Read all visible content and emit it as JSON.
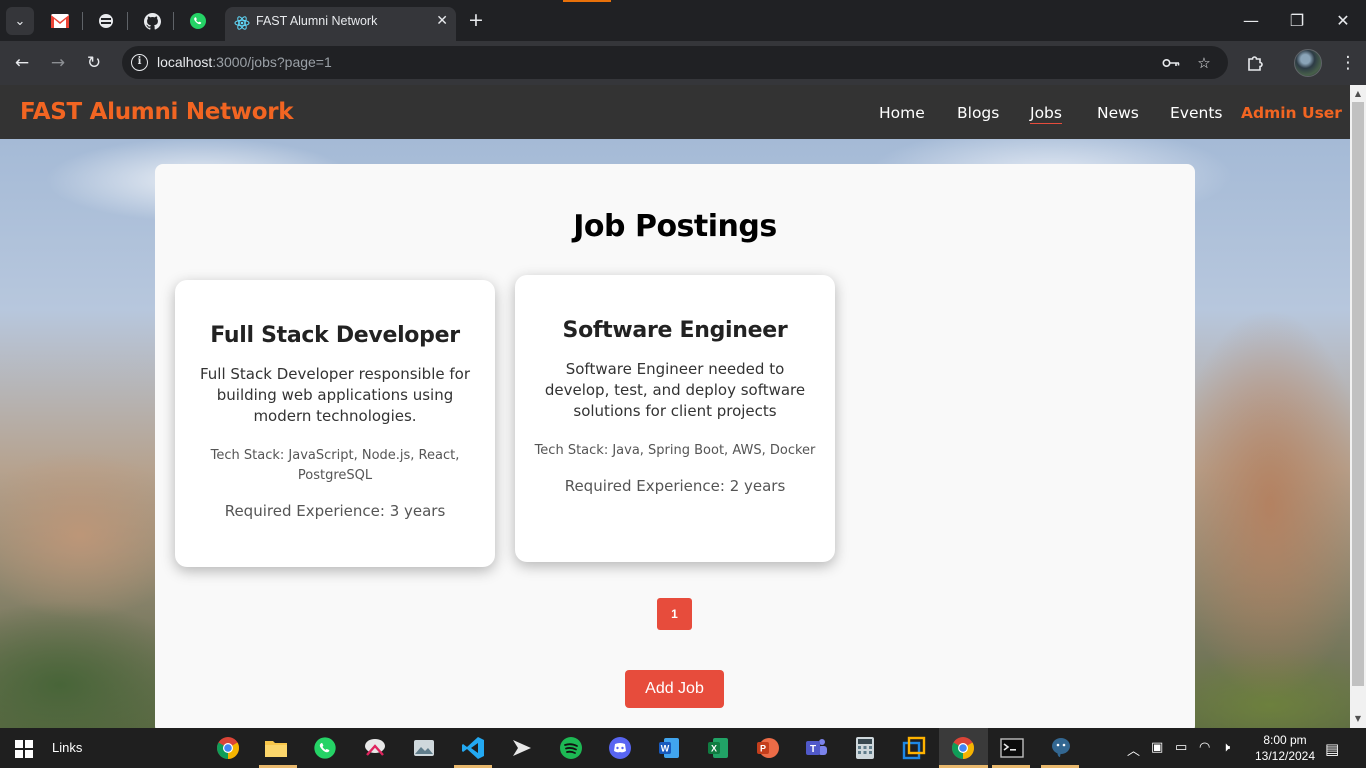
{
  "browser": {
    "tab_title": "FAST Alumni Network",
    "url_host": "localhost",
    "url_path": ":3000/jobs?page=1"
  },
  "site": {
    "brand": "FAST Alumni Network",
    "nav": {
      "home": "Home",
      "blogs": "Blogs",
      "jobs": "Jobs",
      "news": "News",
      "events": "Events",
      "admin": "Admin User"
    },
    "heading": "Job Postings",
    "jobs": [
      {
        "title": "Full Stack Developer",
        "description": "Full Stack Developer responsible for building web applications using modern technologies.",
        "tech": "Tech Stack: JavaScript, Node.js, React, PostgreSQL",
        "experience": "Required Experience: 3 years"
      },
      {
        "title": "Software Engineer",
        "description": "Software Engineer needed to develop, test, and deploy software solutions for client projects",
        "tech": "Tech Stack: Java, Spring Boot, AWS, Docker",
        "experience": "Required Experience: 2 years"
      }
    ],
    "pagination": {
      "current_page": "1"
    },
    "add_job_label": "Add Job"
  },
  "taskbar": {
    "links_label": "Links",
    "time": "8:00 pm",
    "date": "13/12/2024"
  },
  "colors": {
    "brand_orange": "#f26522",
    "accent_red": "#e74c3c",
    "nav_bg": "#333333"
  }
}
